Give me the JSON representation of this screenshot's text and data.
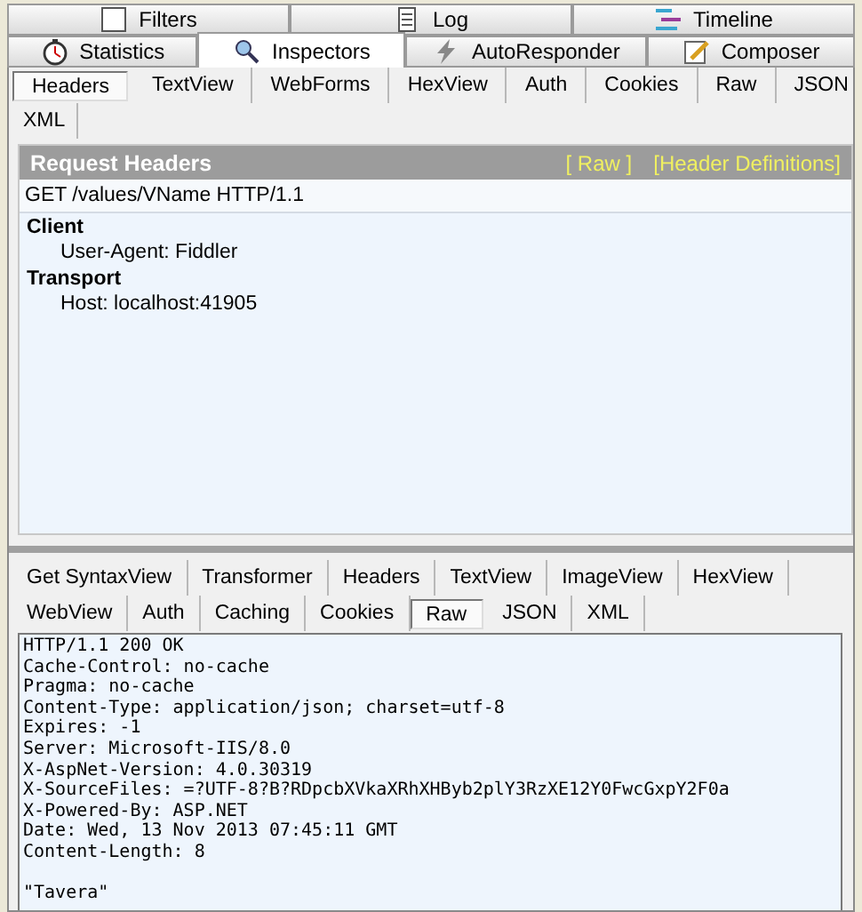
{
  "main_tabs": [
    [
      {
        "label": "Filters",
        "selected": false
      },
      {
        "label": "Log",
        "selected": false
      },
      {
        "label": "Timeline",
        "selected": false
      }
    ],
    [
      {
        "label": "Statistics",
        "selected": false
      },
      {
        "label": "Inspectors",
        "selected": true
      },
      {
        "label": "AutoResponder",
        "selected": false
      },
      {
        "label": "Composer",
        "selected": false
      }
    ]
  ],
  "request_tabs": [
    [
      {
        "label": "Headers",
        "selected": true
      },
      {
        "label": "TextView",
        "selected": false
      },
      {
        "label": "WebForms",
        "selected": false
      },
      {
        "label": "HexView",
        "selected": false
      },
      {
        "label": "Auth",
        "selected": false
      },
      {
        "label": "Cookies",
        "selected": false
      },
      {
        "label": "Raw",
        "selected": false
      },
      {
        "label": "JSON",
        "selected": false
      }
    ],
    [
      {
        "label": "XML",
        "selected": false
      }
    ]
  ],
  "request_headers": {
    "title": "Request Headers",
    "links": [
      "[ Raw ]",
      "[Header Definitions]"
    ],
    "request_line": "GET /values/VName HTTP/1.1",
    "groups": [
      {
        "name": "Client",
        "items": [
          "User-Agent: Fiddler"
        ]
      },
      {
        "name": "Transport",
        "items": [
          "Host: localhost:41905"
        ]
      }
    ]
  },
  "response_tabs": [
    [
      {
        "label": "Get SyntaxView",
        "selected": false
      },
      {
        "label": "Transformer",
        "selected": false
      },
      {
        "label": "Headers",
        "selected": false
      },
      {
        "label": "TextView",
        "selected": false
      },
      {
        "label": "ImageView",
        "selected": false
      },
      {
        "label": "HexView",
        "selected": false
      }
    ],
    [
      {
        "label": "WebView",
        "selected": false
      },
      {
        "label": "Auth",
        "selected": false
      },
      {
        "label": "Caching",
        "selected": false
      },
      {
        "label": "Cookies",
        "selected": false
      },
      {
        "label": "Raw",
        "selected": true
      },
      {
        "label": "JSON",
        "selected": false
      },
      {
        "label": "XML",
        "selected": false
      }
    ]
  ],
  "response_raw": [
    "HTTP/1.1 200 OK",
    "Cache-Control: no-cache",
    "Pragma: no-cache",
    "Content-Type: application/json; charset=utf-8",
    "Expires: -1",
    "Server: Microsoft-IIS/8.0",
    "X-AspNet-Version: 4.0.30319",
    "X-SourceFiles: =?UTF-8?B?RDpcbXVkaXRhXHByb2plY3RzXE12Y0FwcGxpY2F0a",
    "X-Powered-By: ASP.NET",
    "Date: Wed, 13 Nov 2013 07:45:11 GMT",
    "Content-Length: 8"
  ],
  "response_body": "\"Tavera\""
}
